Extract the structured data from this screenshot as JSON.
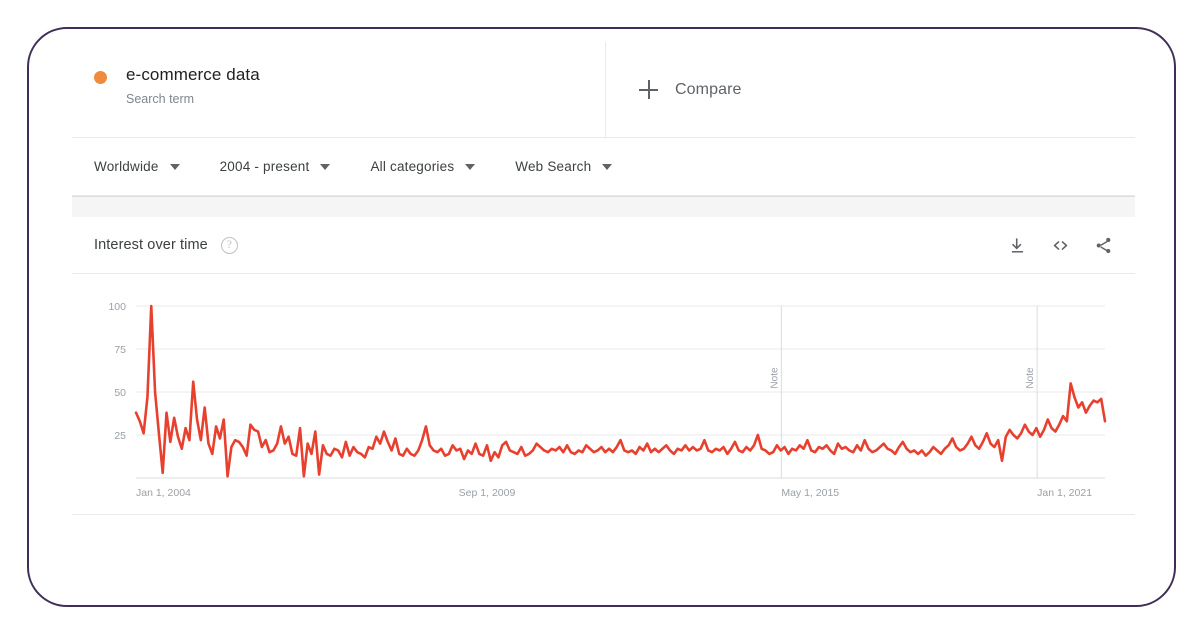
{
  "header": {
    "term": {
      "name": "e-commerce data",
      "type_label": "Search term",
      "dot_color": "#ee8b3c"
    },
    "compare_label": "Compare",
    "plus_icon": "plus-icon"
  },
  "filters": [
    {
      "label": "Worldwide",
      "name": "location"
    },
    {
      "label": "2004 - present",
      "name": "time-range"
    },
    {
      "label": "All categories",
      "name": "category"
    },
    {
      "label": "Web Search",
      "name": "search-type"
    }
  ],
  "card": {
    "title": "Interest over time",
    "help_icon": "?",
    "actions": [
      {
        "name": "download-icon"
      },
      {
        "name": "embed-icon"
      },
      {
        "name": "share-icon"
      }
    ]
  },
  "chart_data": {
    "type": "line",
    "title": "Interest over time",
    "xlabel": "",
    "ylabel": "",
    "ylim": [
      0,
      100
    ],
    "yticks": [
      25,
      50,
      75,
      100
    ],
    "xticks": [
      "Jan 1, 2004",
      "Sep 1, 2009",
      "May 1, 2015",
      "Jan 1, 2021"
    ],
    "xtick_positions": [
      0,
      0.333,
      0.666,
      0.93
    ],
    "grid": true,
    "legend_position": "top-left",
    "line_color": "#e8402e",
    "annotations": [
      {
        "label": "Note",
        "x": 0.666
      },
      {
        "label": "Note",
        "x": 0.93
      }
    ],
    "series": [
      {
        "name": "e-commerce data",
        "values": [
          38,
          33,
          26,
          47,
          100,
          50,
          26,
          3,
          38,
          21,
          35,
          24,
          17,
          29,
          22,
          56,
          34,
          22,
          41,
          20,
          14,
          30,
          23,
          34,
          1,
          18,
          22,
          21,
          18,
          13,
          31,
          28,
          27,
          18,
          22,
          15,
          16,
          20,
          30,
          20,
          24,
          14,
          13,
          29,
          1,
          20,
          14,
          27,
          2,
          19,
          14,
          13,
          17,
          16,
          12,
          21,
          13,
          18,
          15,
          14,
          12,
          18,
          17,
          24,
          20,
          27,
          21,
          16,
          23,
          14,
          13,
          17,
          14,
          13,
          16,
          22,
          30,
          19,
          16,
          15,
          17,
          13,
          14,
          19,
          16,
          17,
          11,
          16,
          14,
          20,
          14,
          13,
          19,
          10,
          15,
          12,
          19,
          21,
          16,
          15,
          14,
          18,
          13,
          14,
          16,
          20,
          18,
          16,
          15,
          17,
          16,
          18,
          15,
          19,
          15,
          14,
          16,
          15,
          19,
          17,
          15,
          16,
          18,
          15,
          17,
          15,
          18,
          22,
          16,
          15,
          16,
          14,
          18,
          16,
          20,
          15,
          17,
          15,
          17,
          19,
          16,
          14,
          17,
          16,
          19,
          16,
          18,
          16,
          17,
          22,
          16,
          15,
          17,
          16,
          18,
          14,
          17,
          21,
          16,
          15,
          18,
          16,
          19,
          25,
          17,
          16,
          14,
          15,
          19,
          16,
          18,
          14,
          17,
          16,
          19,
          17,
          22,
          16,
          15,
          18,
          17,
          19,
          16,
          14,
          20,
          17,
          18,
          16,
          15,
          19,
          16,
          22,
          17,
          15,
          16,
          18,
          20,
          17,
          16,
          14,
          18,
          21,
          17,
          15,
          16,
          14,
          16,
          13,
          15,
          18,
          16,
          14,
          17,
          19,
          23,
          18,
          16,
          17,
          20,
          24,
          19,
          17,
          21,
          26,
          20,
          18,
          22,
          10,
          24,
          28,
          25,
          23,
          26,
          31,
          27,
          25,
          29,
          24,
          28,
          34,
          29,
          27,
          31,
          36,
          33,
          55,
          47,
          41,
          44,
          38,
          42,
          45,
          44,
          46,
          33
        ]
      }
    ]
  }
}
